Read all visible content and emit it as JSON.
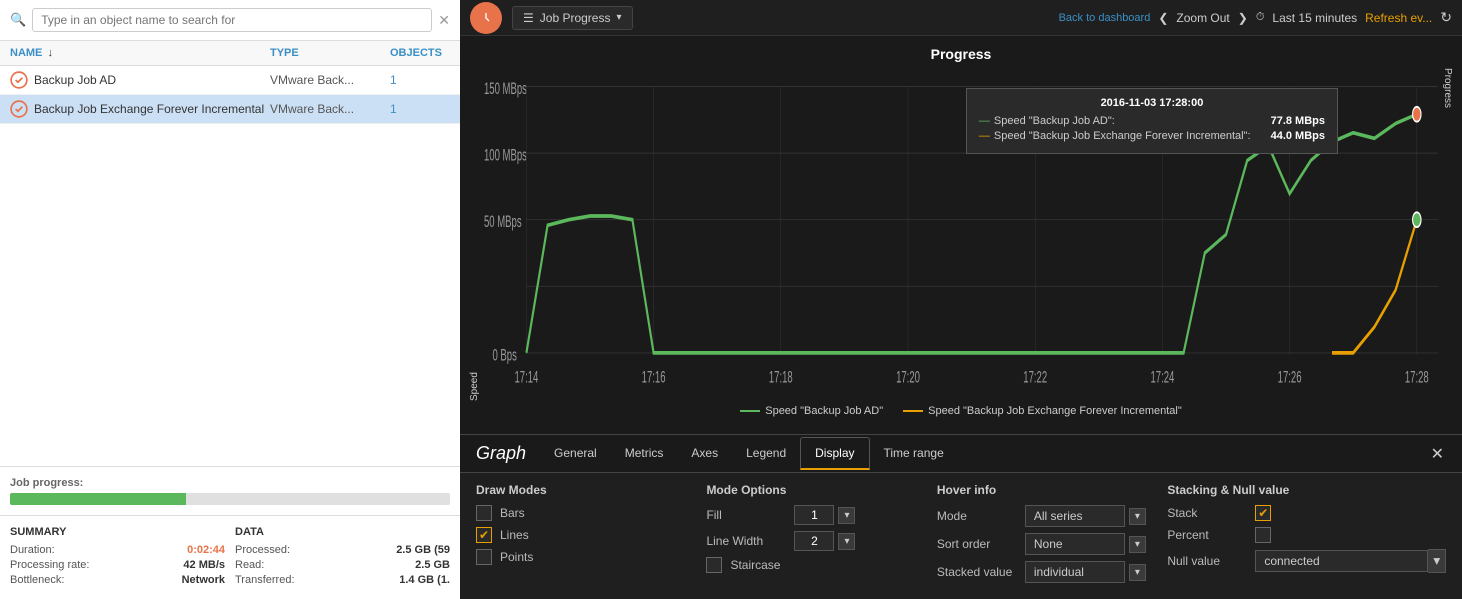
{
  "left": {
    "search_placeholder": "Type in an object name to search for",
    "columns": {
      "name": "NAME",
      "type": "TYPE",
      "objects": "OBJECTS"
    },
    "rows": [
      {
        "name": "Backup Job AD",
        "type": "VMware Back...",
        "objects": "1",
        "selected": false
      },
      {
        "name": "Backup Job Exchange Forever Incremental",
        "type": "VMware Back...",
        "objects": "1",
        "selected": true
      }
    ],
    "job_progress_label": "Job progress:",
    "summary": {
      "title": "SUMMARY",
      "rows": [
        {
          "key": "Duration:",
          "val": "0:02:44",
          "colored": true
        },
        {
          "key": "Processing rate:",
          "val": "42 MB/s",
          "colored": false
        },
        {
          "key": "Bottleneck:",
          "val": "Network",
          "colored": false
        }
      ]
    },
    "data": {
      "title": "DATA",
      "rows": [
        {
          "key": "Processed:",
          "val": "2.5 GB (59",
          "colored": false
        },
        {
          "key": "Read:",
          "val": "2.5 GB",
          "colored": false
        },
        {
          "key": "Transferred:",
          "val": "1.4 GB (1.",
          "colored": false
        }
      ]
    }
  },
  "topbar": {
    "job_progress_btn": "Job Progress",
    "back_label": "Back to dashboard",
    "zoom_out": "Zoom Out",
    "last_label": "Last 15 minutes",
    "refresh_label": "Refresh ev..."
  },
  "chart": {
    "title": "Progress",
    "y_label": "Speed",
    "x_label": "Progress",
    "y_ticks": [
      "150 MBps",
      "100 MBps",
      "50 MBps",
      "0 Bps"
    ],
    "x_ticks": [
      "17:14",
      "17:16",
      "17:18",
      "17:20",
      "17:22",
      "17:24",
      "17:26",
      "17:28"
    ],
    "tooltip": {
      "title": "2016-11-03 17:28:00",
      "rows": [
        {
          "label": "Speed \"Backup Job AD\":",
          "val": "77.8 MBps",
          "color": "green"
        },
        {
          "label": "Speed \"Backup Job Exchange Forever Incremental\":",
          "val": "44.0 MBps",
          "color": "yellow"
        }
      ]
    },
    "legend": [
      {
        "label": "Speed \"Backup Job AD\"",
        "color": "green"
      },
      {
        "label": "Speed \"Backup Job Exchange Forever Incremental\"",
        "color": "yellow"
      }
    ]
  },
  "bottom": {
    "graph_label": "Graph",
    "tabs": [
      {
        "label": "General",
        "active": false
      },
      {
        "label": "Metrics",
        "active": false
      },
      {
        "label": "Axes",
        "active": false
      },
      {
        "label": "Legend",
        "active": false
      },
      {
        "label": "Display",
        "active": true
      },
      {
        "label": "Time range",
        "active": false
      }
    ],
    "sections": {
      "draw_modes": {
        "title": "Draw Modes",
        "items": [
          {
            "label": "Bars",
            "checked": false
          },
          {
            "label": "Lines",
            "checked": true
          },
          {
            "label": "Points",
            "checked": false
          }
        ]
      },
      "mode_options": {
        "title": "Mode Options",
        "fill_label": "Fill",
        "fill_val": "1",
        "line_width_label": "Line Width",
        "line_width_val": "2",
        "staircase_label": "Staircase",
        "staircase_checked": false
      },
      "hover_info": {
        "title": "Hover info",
        "mode_label": "Mode",
        "mode_val": "All series",
        "sort_label": "Sort order",
        "sort_val": "None",
        "stacked_label": "Stacked value",
        "stacked_val": "individual"
      },
      "stacking": {
        "title": "Stacking & Null value",
        "stack_label": "Stack",
        "stack_checked": true,
        "percent_label": "Percent",
        "percent_checked": false,
        "null_label": "Null value",
        "null_val": "connected"
      }
    }
  }
}
